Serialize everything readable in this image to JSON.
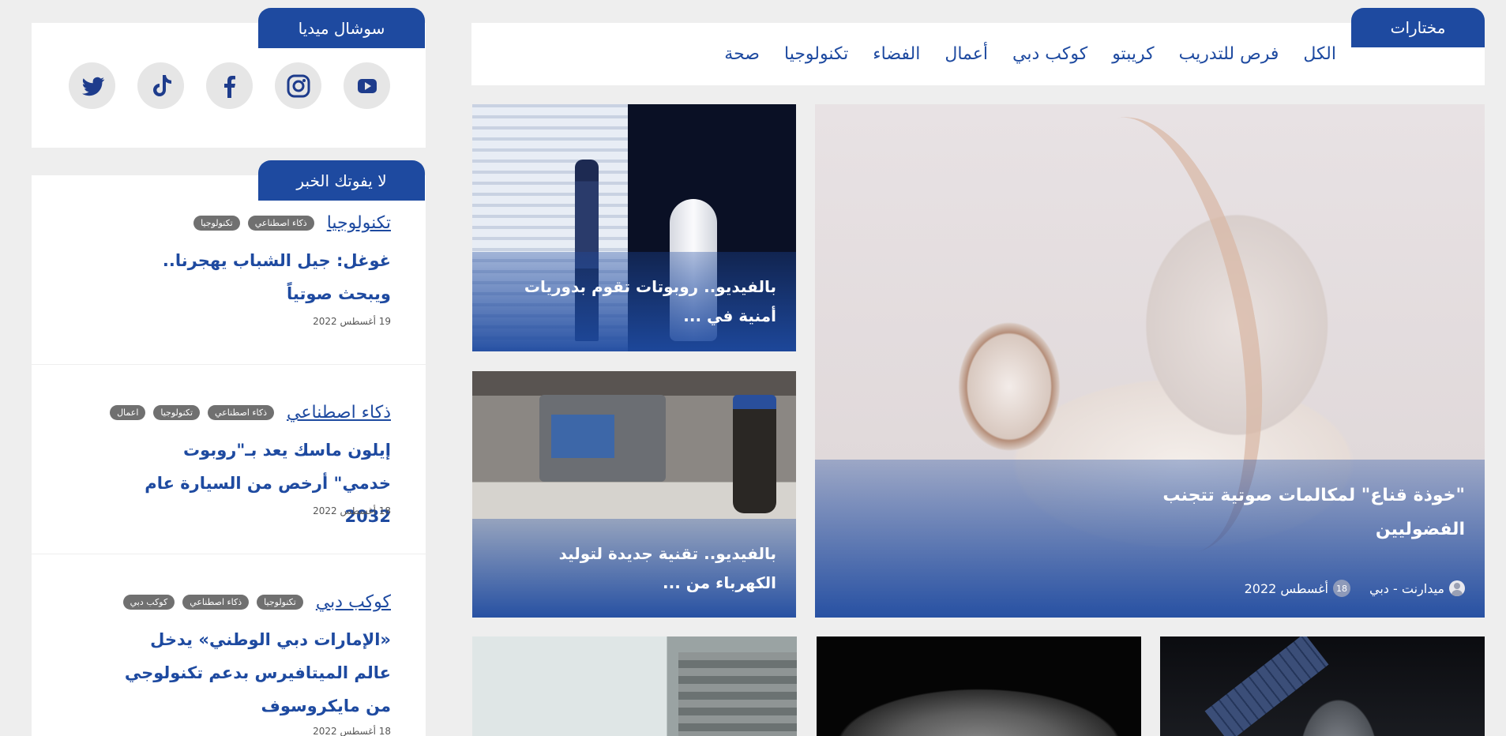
{
  "picks": {
    "heading": "مختارات",
    "filters": [
      "الكل",
      "فرص للتدريب",
      "كريبتو",
      "كوكب دبي",
      "أعمال",
      "الفضاء",
      "تكنولوجيا",
      "صحة"
    ]
  },
  "featured": {
    "title": "\"خوذة قناع\" لمكالمات صوتية تتجنب الفضوليين",
    "author": "ميدارنت - دبي",
    "day_badge": "18",
    "date": "أغسطس 2022"
  },
  "side_cards": [
    {
      "title": "بالفيديو.. روبوتات تقوم بدوريات أمنية في ..."
    },
    {
      "title": "بالفيديو.. تقنية جديدة لتوليد الكهرباء من ..."
    }
  ],
  "social": {
    "heading": "سوشال ميديا",
    "icons": [
      "youtube-icon",
      "instagram-icon",
      "facebook-icon",
      "tiktok-icon",
      "twitter-icon"
    ]
  },
  "dont_miss": {
    "heading": "لا يفوتك الخبر",
    "items": [
      {
        "category": "تكنولوجيا",
        "tags": [
          "ذكاء اصطناعي",
          "تكنولوجيا"
        ],
        "title": "غوغل: جيل الشباب يهجرنا.. ويبحث صوتياً",
        "date": "19 أغسطس 2022"
      },
      {
        "category": "ذكاء اصطناعي",
        "tags": [
          "ذكاء اصطناعي",
          "تكنولوجيا",
          "اعمال"
        ],
        "title": "إيلون ماسك يعد بـ\"روبوت خدمي\" أرخص من السيارة عام 2032",
        "date": "18 أغسطس 2022"
      },
      {
        "category": "كوكب دبي",
        "tags": [
          "تكنولوجيا",
          "ذكاء اصطناعي",
          "كوكب دبي"
        ],
        "title": "«الإمارات دبي الوطني» يدخل عالم الميتافيرس بدعم تكنولوجي من مايكروسوف",
        "date": "18 أغسطس 2022"
      }
    ]
  },
  "colors": {
    "brand": "#1e4aa0",
    "background": "#eeeeee",
    "tag": "#707070"
  }
}
